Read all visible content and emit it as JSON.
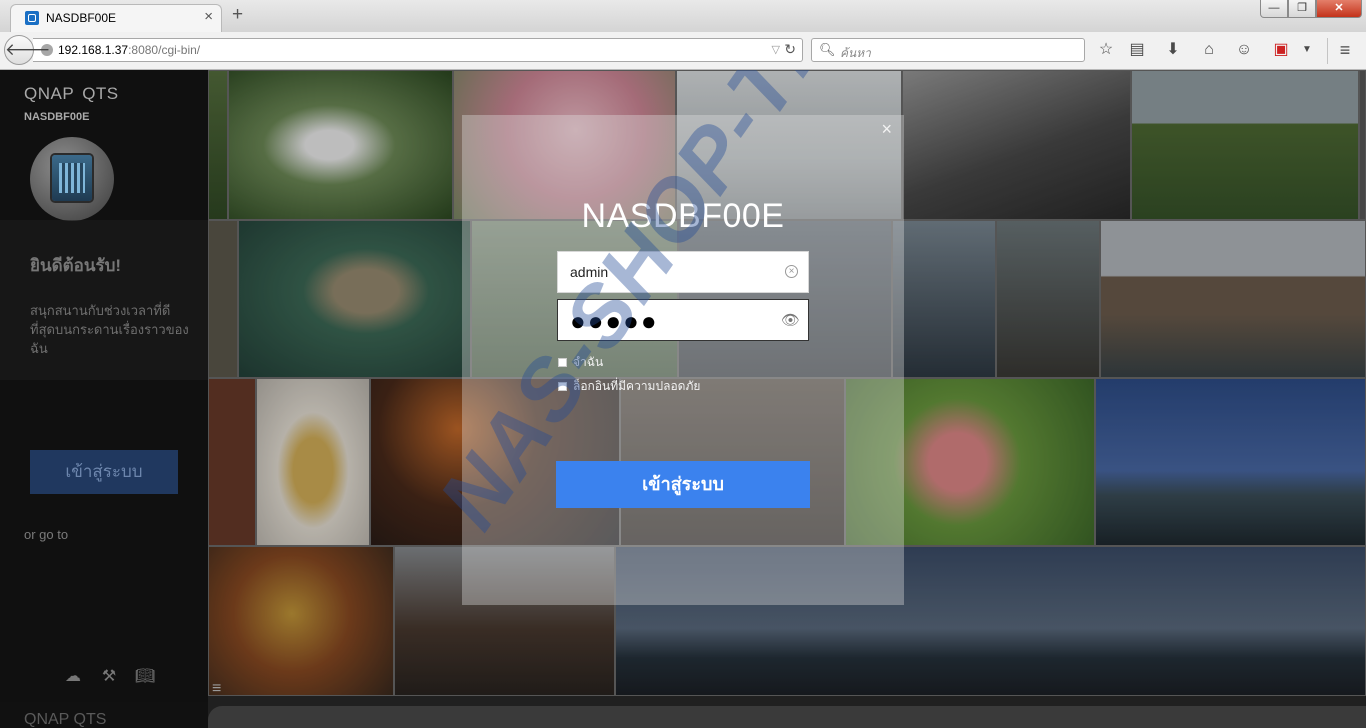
{
  "browser": {
    "tab_title": "NASDBF00E",
    "tab_close": "×",
    "new_tab": "+",
    "url_host": "192.168.1.37",
    "url_port": ":8080",
    "url_path": "/cgi-bin/",
    "search_placeholder": "ค้นหา",
    "window_controls": [
      "—",
      "❐",
      "✕"
    ],
    "toolbar_icons": [
      "star-icon",
      "reading-list-icon",
      "download-icon",
      "home-icon",
      "chat-icon",
      "pdf-icon",
      "menu-icon"
    ]
  },
  "sidebar": {
    "brand": "QNAP",
    "product": "QTS",
    "hostname": "NASDBF00E",
    "welcome": "ยินดีต้อนรับ!",
    "description": "สนุกสนานกับช่วงเวลาที่ดีที่สุดบนกระดานเรื่องราวของฉัน",
    "login_label": "เข้าสู่ระบบ",
    "goto_label": "or go to",
    "bottom_brand": "QNAP",
    "bottom_product": "QTS",
    "tools": [
      "cloud-icon",
      "tools-icon",
      "book-icon"
    ]
  },
  "login": {
    "title": "NASDBF00E",
    "username": "admin",
    "password_mask": "●●●●●",
    "remember_label": "จำฉัน",
    "secure_login_label": "ล็อกอินที่มีความปลอดภัย",
    "submit_label": "เข้าสู่ระบบ"
  },
  "watermark": "NAS-SHOP-TH",
  "colors": {
    "login_button": "#3b82ee",
    "sidebar_bg": "#0c0c0c",
    "accent_blue": "#1a6fc4"
  }
}
